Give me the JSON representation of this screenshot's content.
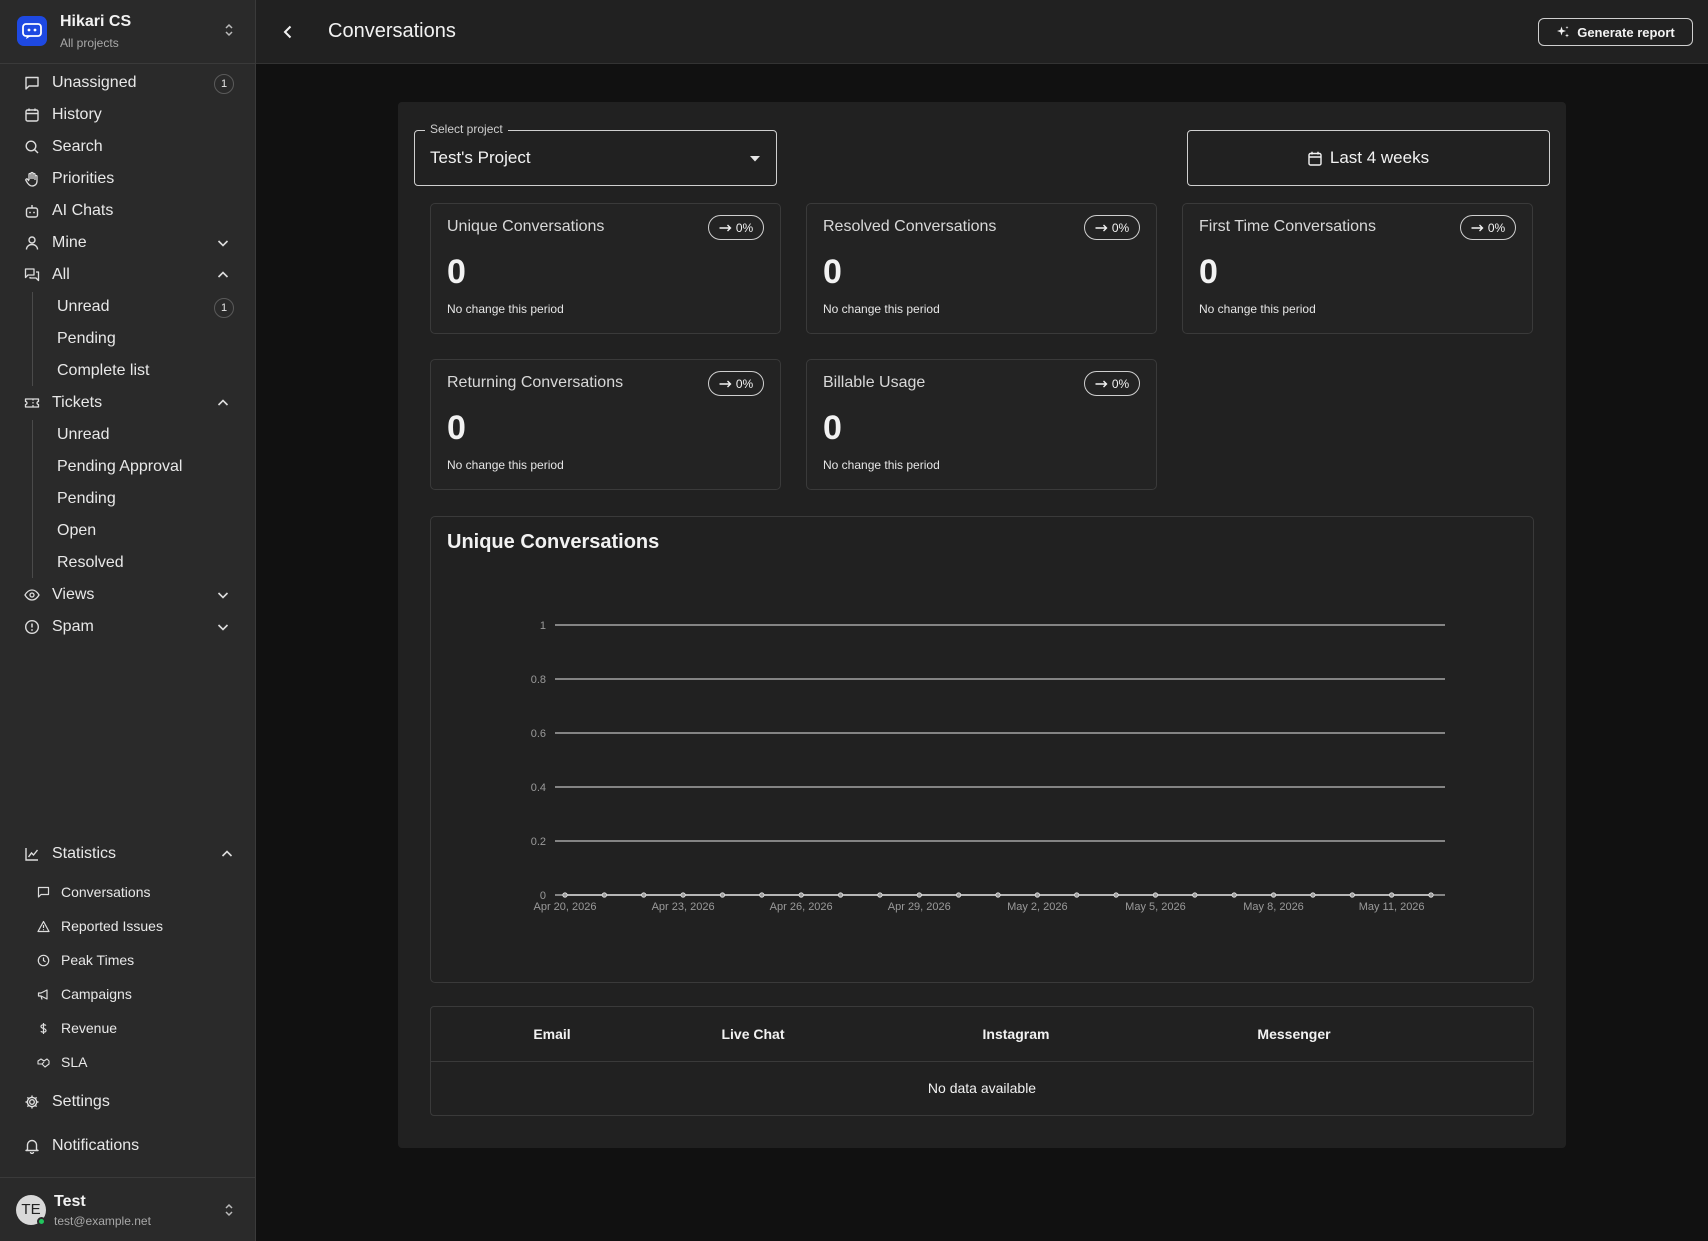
{
  "workspace": {
    "name": "Hikari CS",
    "subtitle": "All projects"
  },
  "sidebar": {
    "unassigned": {
      "label": "Unassigned",
      "badge": "1"
    },
    "history": "History",
    "search": "Search",
    "priorities": "Priorities",
    "ai_chats": "AI Chats",
    "mine": "Mine",
    "all": {
      "label": "All",
      "items": [
        {
          "label": "Unread",
          "badge": "1"
        },
        {
          "label": "Pending"
        },
        {
          "label": "Complete list"
        }
      ]
    },
    "tickets": {
      "label": "Tickets",
      "items": [
        "Unread",
        "Pending Approval",
        "Pending",
        "Open",
        "Resolved"
      ]
    },
    "views": "Views",
    "spam": "Spam",
    "statistics": {
      "label": "Statistics",
      "items": [
        "Conversations",
        "Reported Issues",
        "Peak Times",
        "Campaigns",
        "Revenue",
        "SLA"
      ]
    },
    "settings": "Settings",
    "notifications": "Notifications"
  },
  "user": {
    "initials": "TE",
    "name": "Test",
    "email": "test@example.net"
  },
  "header": {
    "title": "Conversations",
    "generate_report": "Generate report"
  },
  "filters": {
    "project_legend": "Select project",
    "project_value": "Test's Project",
    "date_range": "Last 4 weeks"
  },
  "cards": [
    {
      "title": "Unique Conversations",
      "change": "0%",
      "value": "0",
      "note": "No change this period"
    },
    {
      "title": "Resolved Conversations",
      "change": "0%",
      "value": "0",
      "note": "No change this period"
    },
    {
      "title": "First Time Conversations",
      "change": "0%",
      "value": "0",
      "note": "No change this period"
    },
    {
      "title": "Returning Conversations",
      "change": "0%",
      "value": "0",
      "note": "No change this period"
    },
    {
      "title": "Billable Usage",
      "change": "0%",
      "value": "0",
      "note": "No change this period"
    }
  ],
  "chart_data": {
    "type": "line",
    "title": "Unique Conversations",
    "xlabel": "",
    "ylabel": "",
    "ylim": [
      0,
      1
    ],
    "y_ticks": [
      "0",
      "0.2",
      "0.4",
      "0.6",
      "0.8",
      "1"
    ],
    "x_tick_labels": [
      "Apr 20, 2026",
      "Apr 23, 2026",
      "Apr 26, 2026",
      "Apr 29, 2026",
      "May 2, 2026",
      "May 5, 2026",
      "May 8, 2026",
      "May 11, 2026"
    ],
    "x": [
      "2026-04-20",
      "2026-04-21",
      "2026-04-22",
      "2026-04-23",
      "2026-04-24",
      "2026-04-25",
      "2026-04-26",
      "2026-04-27",
      "2026-04-28",
      "2026-04-29",
      "2026-04-30",
      "2026-05-01",
      "2026-05-02",
      "2026-05-03",
      "2026-05-04",
      "2026-05-05",
      "2026-05-06",
      "2026-05-07",
      "2026-05-08",
      "2026-05-09",
      "2026-05-10",
      "2026-05-11",
      "2026-05-12"
    ],
    "series": [
      {
        "values": [
          0,
          0,
          0,
          0,
          0,
          0,
          0,
          0,
          0,
          0,
          0,
          0,
          0,
          0,
          0,
          0,
          0,
          0,
          0,
          0,
          0,
          0,
          0
        ]
      }
    ],
    "grid": true
  },
  "channels_table": {
    "columns": [
      "Email",
      "Live Chat",
      "Instagram",
      "Messenger"
    ],
    "empty": "No data available"
  }
}
